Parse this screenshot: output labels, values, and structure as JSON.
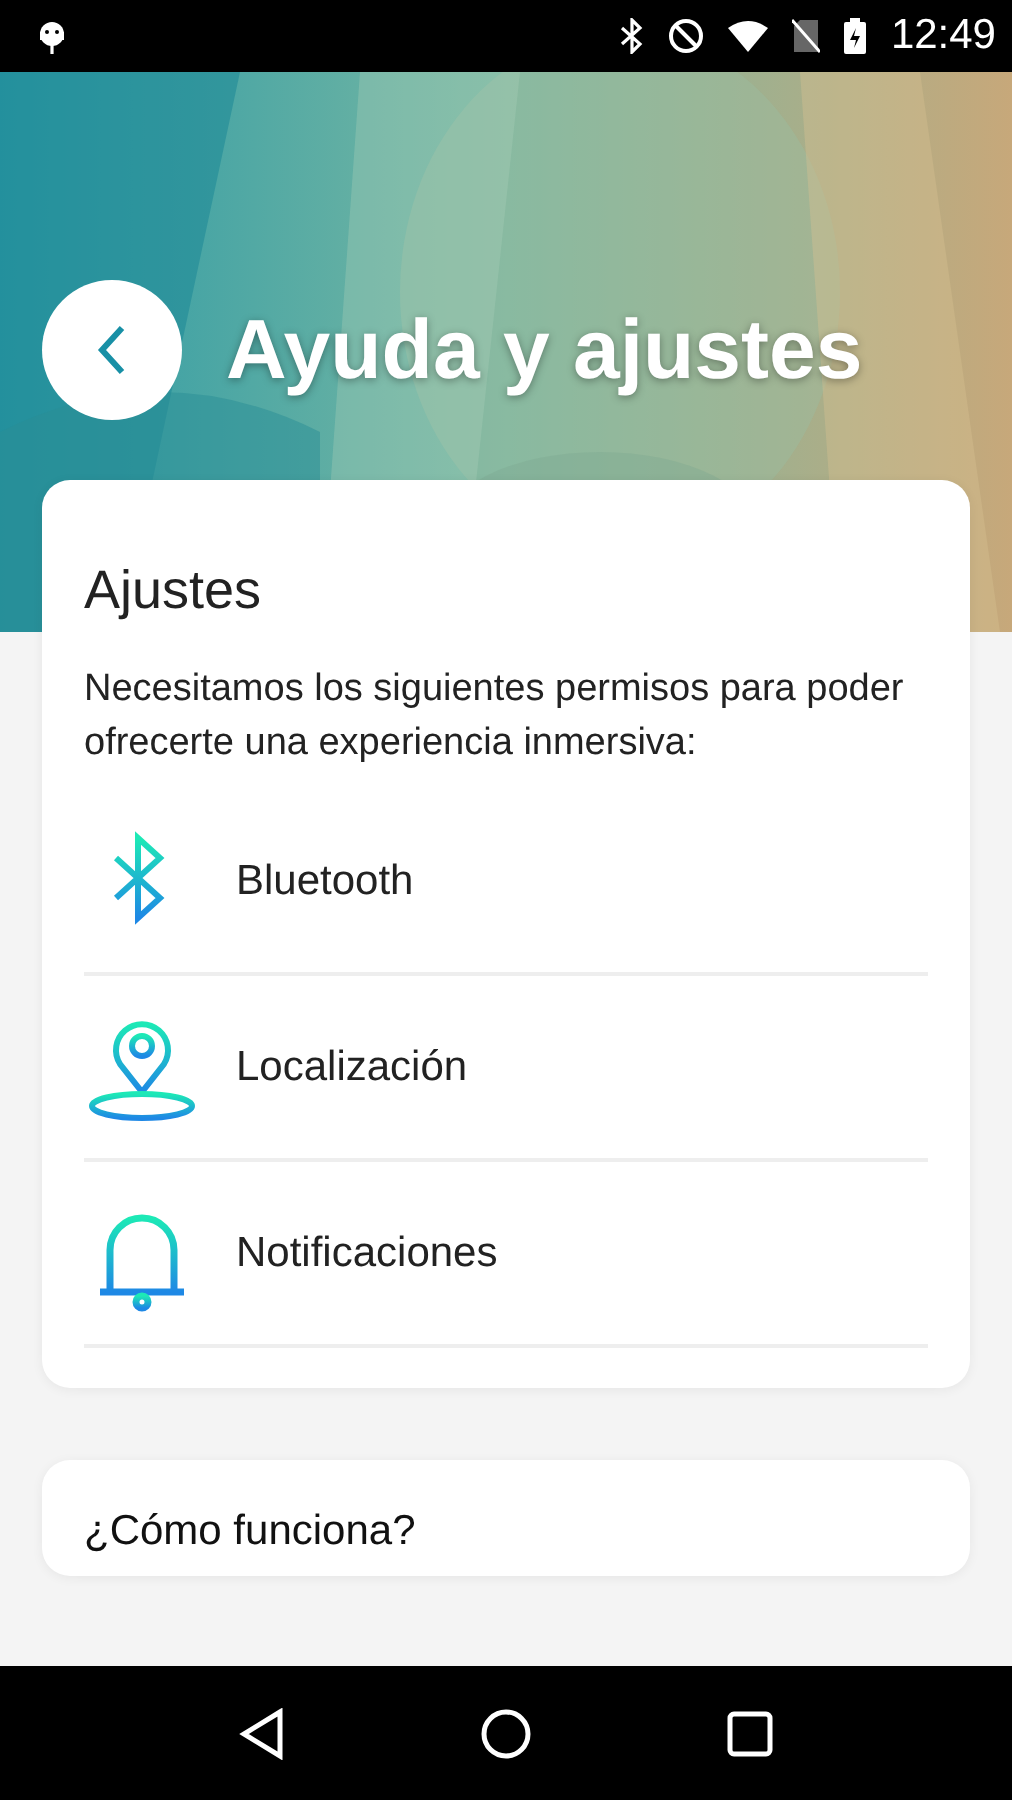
{
  "status_bar": {
    "time": "12:49"
  },
  "header": {
    "title": "Ayuda y ajustes"
  },
  "settings_card": {
    "title": "Ajustes",
    "description": "Necesitamos los siguientes permisos para poder ofrecerte una experiencia inmersiva:",
    "permissions": [
      {
        "kind": "bluetooth",
        "label": "Bluetooth"
      },
      {
        "kind": "location",
        "label": "Localización"
      },
      {
        "kind": "notifications",
        "label": "Notificaciones"
      }
    ]
  },
  "help_card": {
    "title": "¿Cómo funciona?"
  }
}
